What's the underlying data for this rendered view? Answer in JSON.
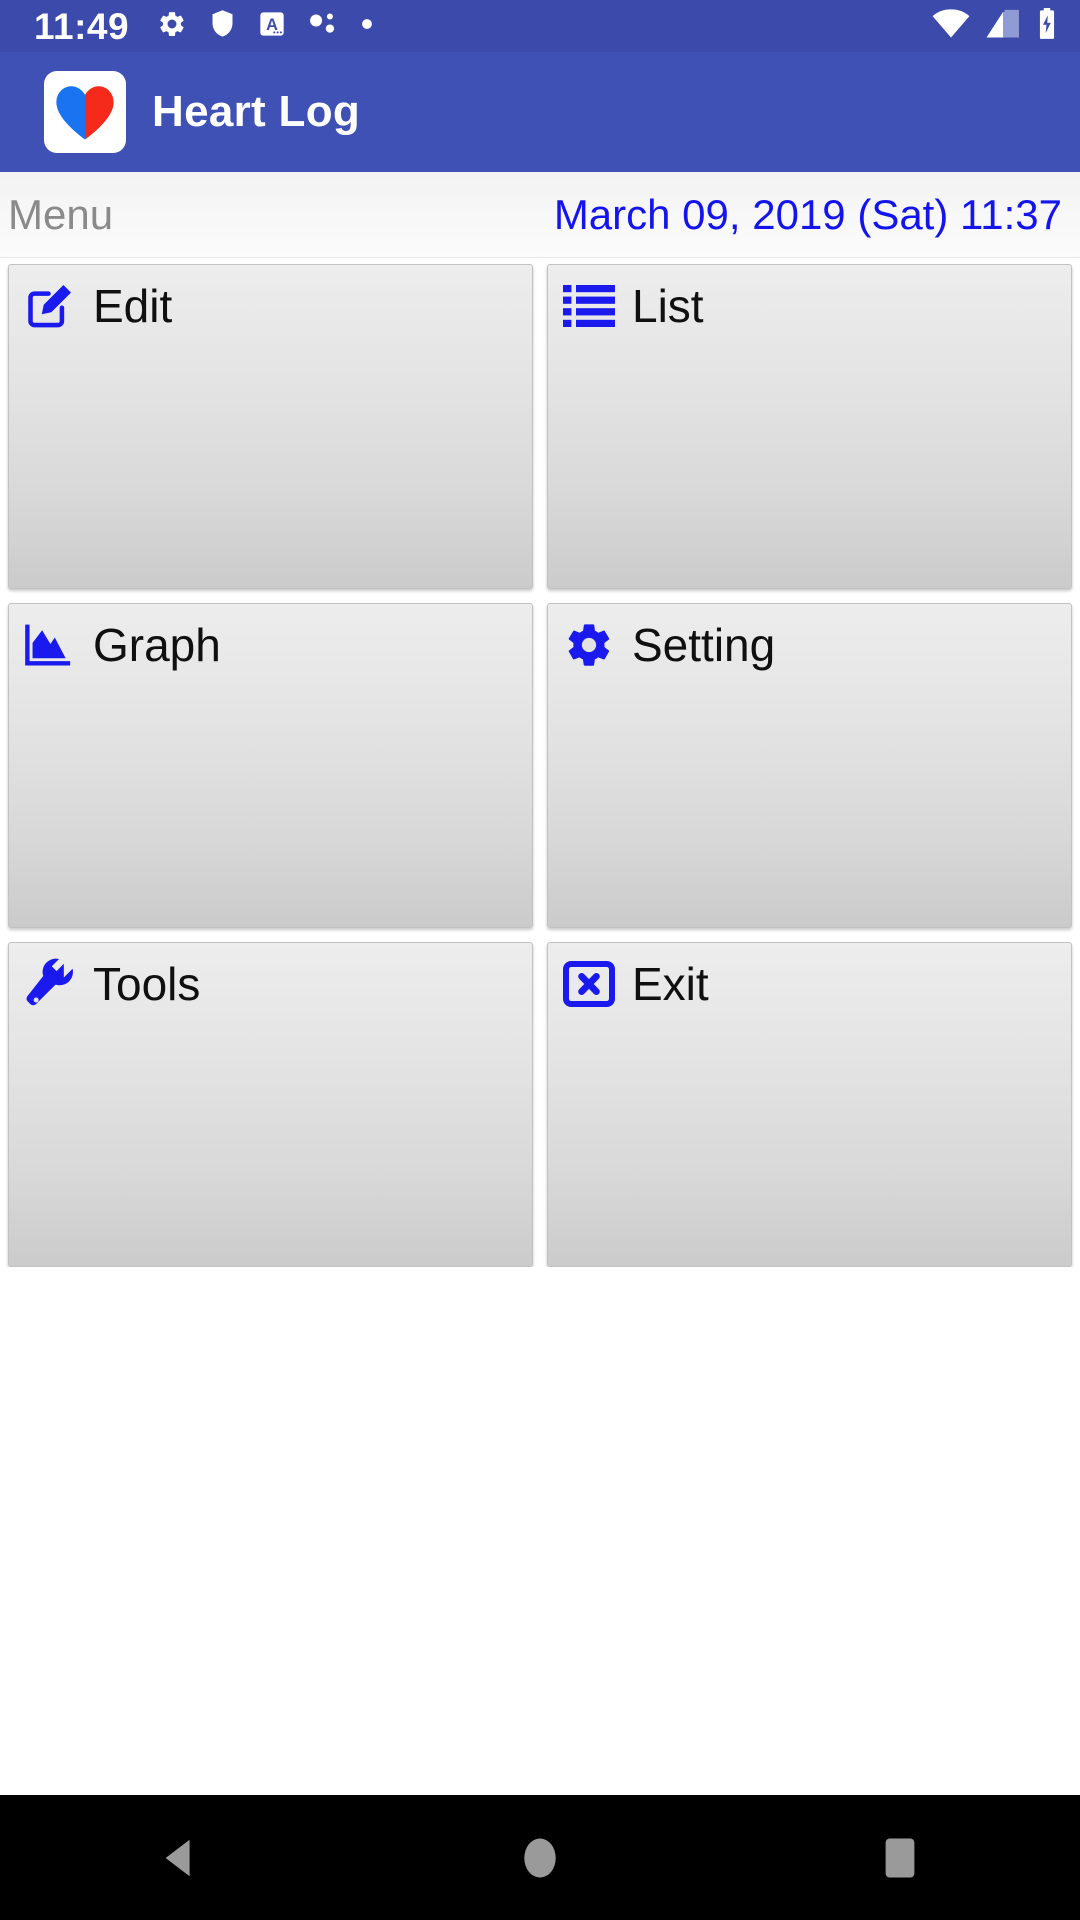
{
  "status_bar": {
    "clock": "11:49",
    "left_icons": [
      "gear-icon",
      "shield-icon",
      "letter-a-icon",
      "dots-icon",
      "dot-icon"
    ],
    "right_icons": [
      "wifi-icon",
      "cellular-signal-icon",
      "battery-charging-icon"
    ],
    "background_color": "#3b4aab"
  },
  "header": {
    "title": "Heart Log",
    "logo_icon": "heart-logo-icon",
    "logo_left_color": "#1a73f0",
    "logo_right_color": "#f62a1a",
    "background_color": "#3f51b5"
  },
  "menu_bar": {
    "label": "Menu",
    "date": "March 09, 2019 (Sat) 11:37",
    "label_color": "#8a8a8a",
    "date_color": "#1414ee"
  },
  "tiles": [
    {
      "label": "Edit",
      "icon": "edit-pencil-icon",
      "color": "#1a1aee"
    },
    {
      "label": "List",
      "icon": "list-icon",
      "color": "#1a1aee"
    },
    {
      "label": "Graph",
      "icon": "area-chart-icon",
      "color": "#1a1aee"
    },
    {
      "label": "Setting",
      "icon": "gear-icon",
      "color": "#1a1aee"
    },
    {
      "label": "Tools",
      "icon": "wrench-icon",
      "color": "#1a1aee"
    },
    {
      "label": "Exit",
      "icon": "exit-x-box-icon",
      "color": "#1a1aee"
    }
  ],
  "nav_bar": {
    "buttons": [
      "back-icon",
      "home-icon",
      "recents-icon"
    ],
    "icon_color": "#9a9a9a",
    "background_color": "#000000"
  }
}
